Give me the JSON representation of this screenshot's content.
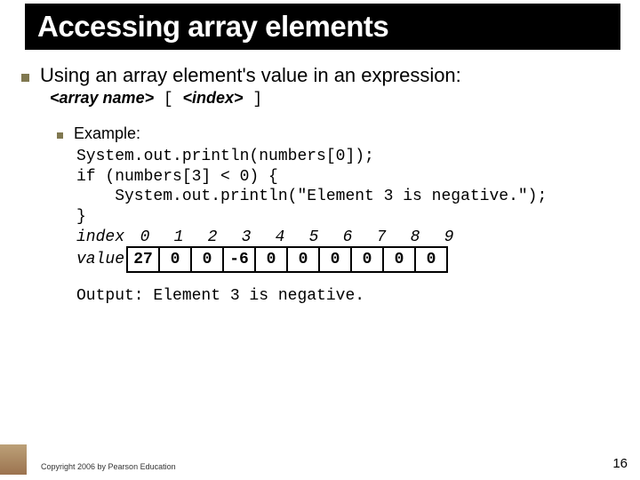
{
  "title": "Accessing array elements",
  "bullet1": "Using an array element's value in an expression:",
  "syntax": {
    "arrayname": "<array name>",
    "lb": " [ ",
    "index": "<index>",
    "rb": " ]"
  },
  "example_label": "Example:",
  "code": "System.out.println(numbers[0]);\nif (numbers[3] < 0) {\n    System.out.println(\"Element 3 is negative.\");\n}",
  "array": {
    "index_label": "index",
    "value_label": "value",
    "indices": [
      "0",
      "1",
      "2",
      "3",
      "4",
      "5",
      "6",
      "7",
      "8",
      "9"
    ],
    "values": [
      "27",
      "0",
      "0",
      "-6",
      "0",
      "0",
      "0",
      "0",
      "0",
      "0"
    ]
  },
  "output": "Output: Element 3 is negative.",
  "copyright": "Copyright 2006 by Pearson Education",
  "page": "16"
}
